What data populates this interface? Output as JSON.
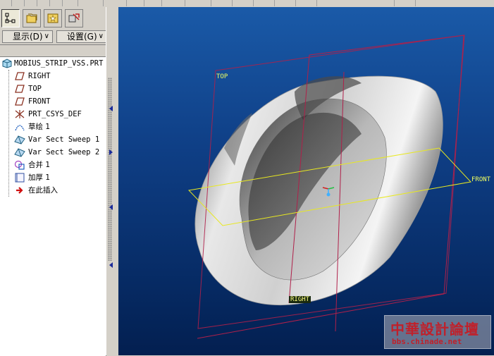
{
  "left_panel": {
    "menus": [
      {
        "label": "显示(D)"
      },
      {
        "label": "设置(G)"
      }
    ],
    "tree": [
      {
        "label": "MOBIUS_STRIP_VSS.PRT",
        "icon": "part-icon"
      },
      {
        "label": "RIGHT",
        "icon": "datum-plane-icon"
      },
      {
        "label": "TOP",
        "icon": "datum-plane-icon"
      },
      {
        "label": "FRONT",
        "icon": "datum-plane-icon"
      },
      {
        "label": "PRT_CSYS_DEF",
        "icon": "coordinate-system-icon"
      },
      {
        "label": "草绘 1",
        "icon": "sketch-icon"
      },
      {
        "label": "Var Sect Sweep 1",
        "icon": "sweep-icon"
      },
      {
        "label": "Var Sect Sweep 2",
        "icon": "sweep-icon"
      },
      {
        "label": "合并 1",
        "icon": "merge-icon"
      },
      {
        "label": "加厚 1",
        "icon": "thicken-icon"
      },
      {
        "label": "在此插入",
        "icon": "insert-here-arrow-icon"
      }
    ]
  },
  "viewport": {
    "plane_labels": {
      "top": "TOP",
      "front": "FRONT",
      "right": "RIGHT"
    }
  },
  "watermark": {
    "title": "中華設計論壇",
    "url": "bbs.chinade.net"
  },
  "colors": {
    "viewport_top": "#1a5aa8",
    "viewport_bottom": "#031f50",
    "datum_plane_red": "#b0204a",
    "datum_plane_yellow": "#e8e820"
  }
}
